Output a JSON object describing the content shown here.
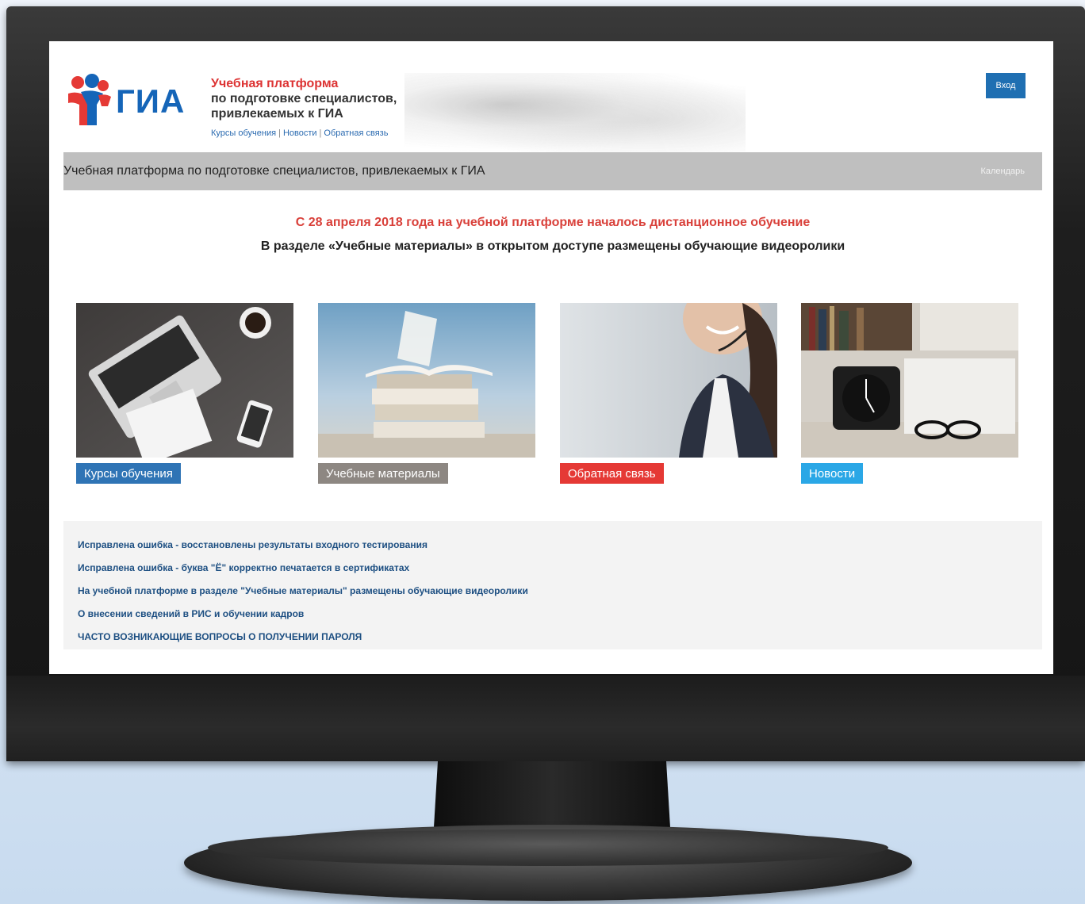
{
  "header": {
    "logo_text": "ГИА",
    "brand_title": "Учебная платформа",
    "brand_subtitle": "по подготовке специалистов, привлекаемых к ГИА",
    "nav": [
      "Курсы обучения",
      "Новости",
      "Обратная связь"
    ],
    "nav_separator": "|",
    "login_label": "Вход"
  },
  "titlebar": {
    "title": "Учебная платформа по подготовке специалистов, привлекаемых к ГИА",
    "calendar_label": "Календарь"
  },
  "announcements": {
    "red": "С 28 апреля 2018 года на учебной платформе началось дистанционное обучение",
    "dark": "В разделе «Учебные материалы» в открытом доступе размещены обучающие видеоролики"
  },
  "tiles": [
    {
      "label": "Курсы обучения",
      "color": "#2f74b5"
    },
    {
      "label": "Учебные материалы",
      "color": "#8d8782"
    },
    {
      "label": "Обратная связь",
      "color": "#e53935"
    },
    {
      "label": "Новости",
      "color": "#2aa7e6"
    }
  ],
  "news": [
    "Исправлена ошибка - восстановлены результаты входного тестирования",
    "Исправлена ошибка - буква \"Ё\" корректно печатается в сертификатах",
    "На учебной платформе в разделе \"Учебные материалы\" размещены обучающие видеоролики",
    "О внесении сведений в РИС и обучении кадров",
    "ЧАСТО ВОЗНИКАЮЩИЕ ВОПРОСЫ О ПОЛУЧЕНИИ ПАРОЛЯ"
  ],
  "colors": {
    "accent_blue": "#1f6fb2",
    "brand_red": "#d33",
    "bar_grey": "#bfbfbf"
  },
  "icons": {
    "logo": "people-logo-icon"
  }
}
